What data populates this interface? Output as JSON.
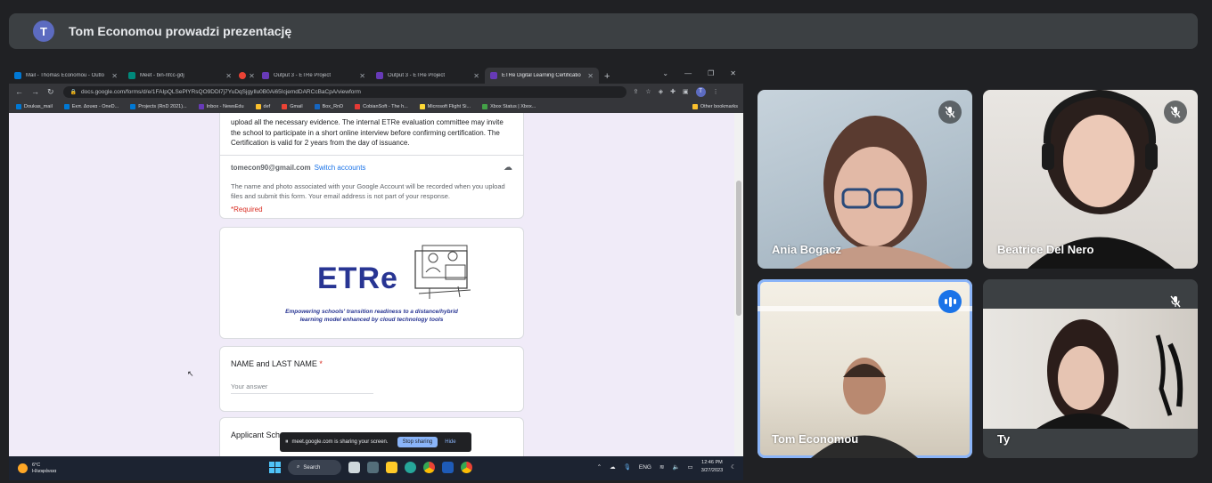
{
  "banner": {
    "avatar_letter": "T",
    "title": "Tom Economou prowadzi prezentację"
  },
  "browser": {
    "tabs": [
      {
        "label": "Mail - Thomas Economou - Outlo",
        "color": "#0078d4"
      },
      {
        "label": "Meet - bin-nfcc-gdj",
        "color": "#00897b"
      },
      {
        "label": "",
        "color": "#ea4335"
      },
      {
        "label": "Output 3 - ETRe Project",
        "color": "#673ab7"
      },
      {
        "label": "Output 3 - ETRe Project",
        "color": "#673ab7"
      },
      {
        "label": "ETRe Digital Learning Certificatio",
        "color": "#673ab7"
      }
    ],
    "url": "docs.google.com/forms/d/e/1FAIpQLSePlYRsQO9DDl7j7YuDqSjgyIlu0B0Ai65IcjemdDARCcBaCpA/viewform",
    "profile_letter": "T",
    "bookmarks": [
      {
        "label": "Doukas_mail",
        "color": "#0078d4"
      },
      {
        "label": "Εκπ. Δουκα - OneD...",
        "color": "#0078d4"
      },
      {
        "label": "Projects (RnD 2021)...",
        "color": "#0078d4"
      },
      {
        "label": "Inbox - NewsEdu",
        "color": "#673ab7"
      },
      {
        "label": "def",
        "color": "#fbc02d"
      },
      {
        "label": "Gmail",
        "color": "#ea4335"
      },
      {
        "label": "Box_RnD",
        "color": "#1565c0"
      },
      {
        "label": "CobianSoft - The h...",
        "color": "#e53935"
      },
      {
        "label": "Microsoft Flight Si...",
        "color": "#fdd835"
      },
      {
        "label": "Xbox Status | Xbox...",
        "color": "#43a047"
      }
    ],
    "other_bookmarks": "Other bookmarks"
  },
  "form": {
    "description": "upload all the necessary evidence. The internal ETRe evaluation committee may invite the school to participate in a short online interview before confirming certification. The Certification is valid for 2 years from the day of issuance.",
    "email": "tomecon90@gmail.com",
    "switch_accounts": "Switch accounts",
    "note": "The name and photo associated with your Google Account will be recorded when you upload files and submit this form. Your email address is not part of your response.",
    "required": "*Required",
    "logo_text": "ETRe",
    "tagline_1": "Empowering schools' transition readiness to a distance/hybrid",
    "tagline_2": "learning model enhanced by cloud technology tools",
    "q1_label": "NAME and LAST NAME",
    "q1_required": "*",
    "q1_placeholder": "Your answer",
    "q2_label": "Applicant Scho"
  },
  "sharebar": {
    "message": "meet.google.com is sharing your screen.",
    "stop": "Stop sharing",
    "hide": "Hide"
  },
  "taskbar": {
    "temp": "6°C",
    "weather": "Ηλιοφάνεια",
    "search": "Search",
    "lang": "ENG",
    "time": "12:46 PM",
    "date": "3/27/2023"
  },
  "participants": [
    {
      "name": "Ania Bogacz",
      "muted": true
    },
    {
      "name": "Beatrice Del Nero",
      "muted": true
    },
    {
      "name": "Tom Economou",
      "speaking": true
    },
    {
      "name": "Ty",
      "muted": true
    }
  ]
}
